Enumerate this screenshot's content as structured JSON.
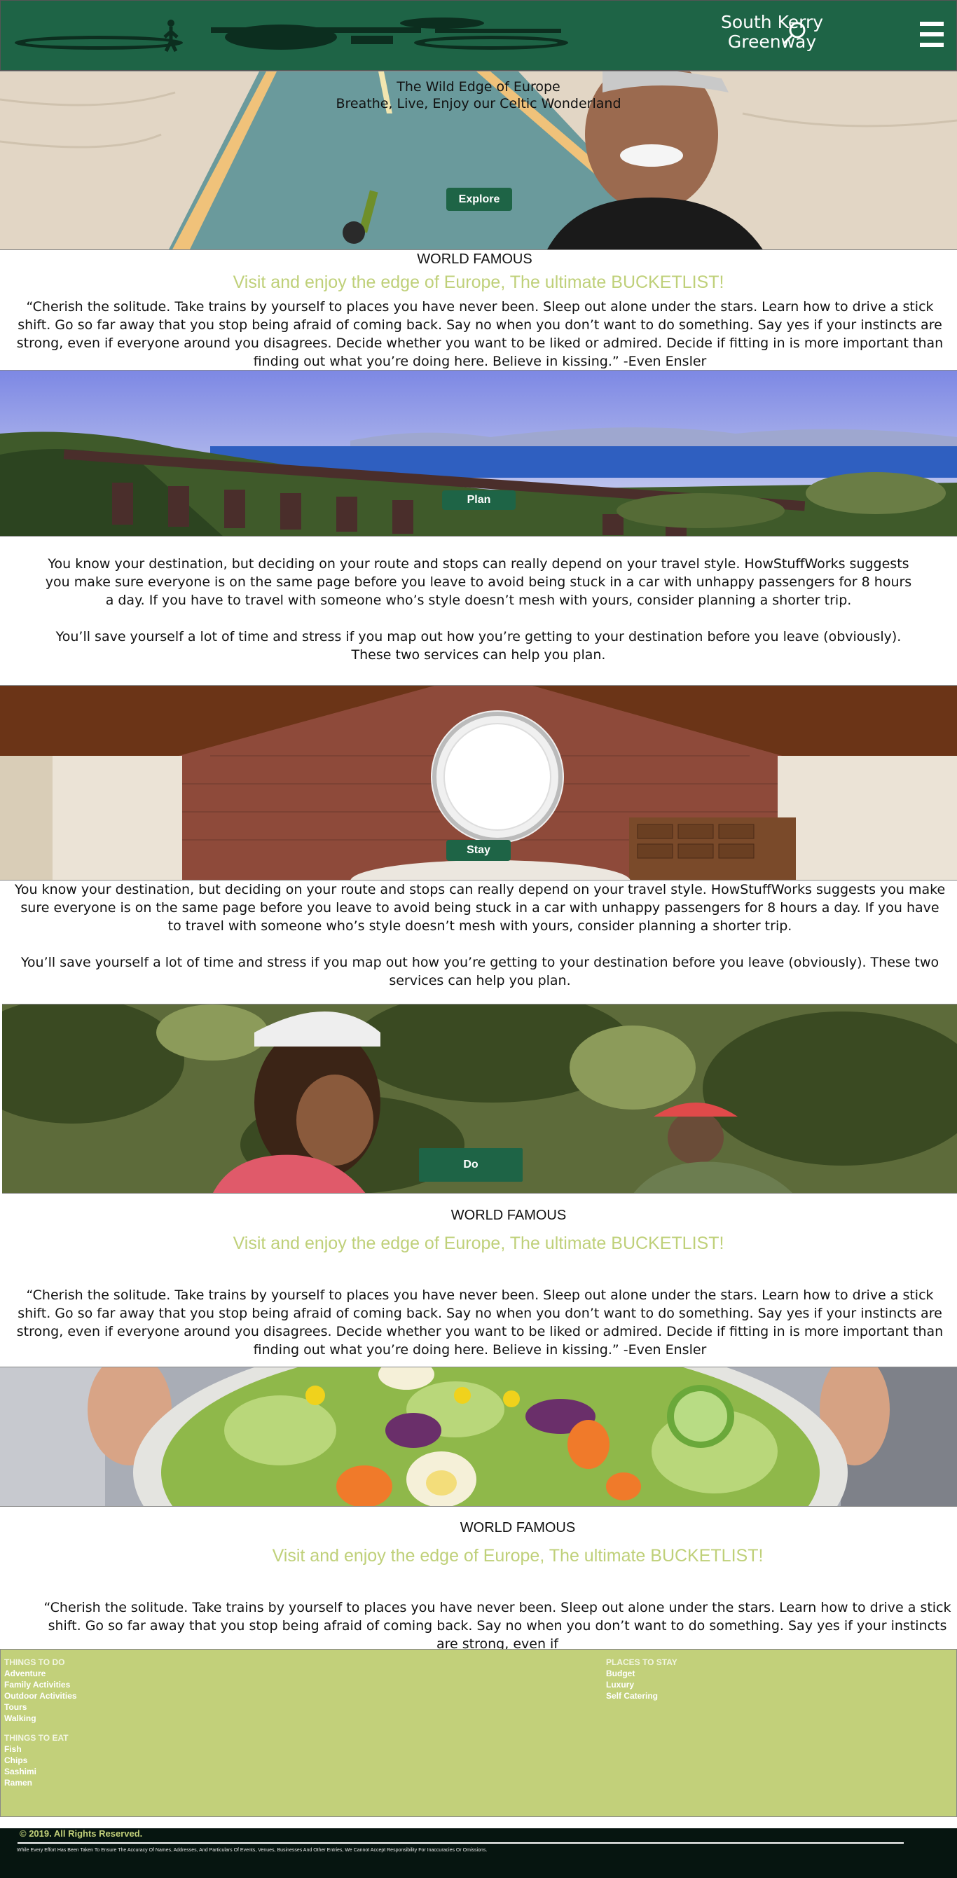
{
  "header": {
    "brand_line1": "South Kerry",
    "brand_line2": "Greenway",
    "menu_icon": "hamburger-icon",
    "search_icon": "search-icon",
    "bg_color": "#1e6446"
  },
  "hero": {
    "title": "The Wild Edge of Europe",
    "subtitle": "Breathe, Live, Enjoy our Celtic Wonderland",
    "button": "Explore"
  },
  "section1": {
    "kicker": "WORLD FAMOUS",
    "headline": "Visit and enjoy the edge of Europe, The ultimate BUCKETLIST!",
    "quote": "“Cherish the solitude. Take trains by yourself to places you have never been. Sleep out alone under the stars. Learn how to drive a stick shift. Go so far away that you stop being afraid of coming back. Say no when you don’t want to do something. Say yes if your instincts are strong, even if everyone around you disagrees. Decide whether you want to be liked or admired. Decide if fitting in is more important than finding out what you’re doing here. Believe in kissing.” -Even Ensler"
  },
  "plan": {
    "button": "Plan",
    "para1": "You know your destination, but deciding on your route and stops can really depend on your travel style. HowStuffWorks suggests you make sure everyone is on the same page before you leave to avoid being stuck in a car with unhappy passengers for 8 hours a day. If you have to travel with someone who’s style doesn’t mesh with yours, consider planning a shorter trip.",
    "para2": "You’ll save yourself a lot of time and stress if you map out how you’re getting to your destination before you leave (obviously). These two services can help you plan."
  },
  "stay": {
    "button": "Stay",
    "para1": "You know your destination, but deciding on your route and stops can really depend on your travel style. HowStuffWorks suggests you make sure everyone is on the same page before you leave to avoid being stuck in a car with unhappy passengers for 8 hours a day. If you have to travel with someone who’s style doesn’t mesh with yours, consider planning a shorter trip.",
    "para2": "You’ll save yourself a lot of time and stress if you map out how you’re getting to your destination before you leave (obviously). These two services can help you plan."
  },
  "do": {
    "button": "Do",
    "kicker": "WORLD FAMOUS",
    "headline": "Visit and enjoy the edge of Europe, The ultimate BUCKETLIST!",
    "quote": "“Cherish the solitude. Take trains by yourself to places you have never been. Sleep out alone under the stars. Learn how to drive a stick shift. Go so far away that you stop being afraid of coming back. Say no when you don’t want to do something. Say yes if your instincts are strong, even if everyone around you disagrees. Decide whether you want to be liked or admired. Decide if fitting in is more important than finding out what you’re doing here. Believe in kissing.” -Even Ensler"
  },
  "eat": {
    "kicker": "WORLD FAMOUS",
    "headline": "Visit and enjoy the edge of Europe, The ultimate BUCKETLIST!",
    "quote": "“Cherish the solitude. Take trains by yourself to places you have never been. Sleep out alone under the stars. Learn how to drive a stick shift. Go so far away that you stop being afraid of coming back. Say no when you don’t want to do something. Say yes if your instincts are strong, even if"
  },
  "footer": {
    "bg_color": "#c2d07a",
    "things_to_do": {
      "heading": "THINGS TO DO",
      "items": [
        "Adventure",
        "Family Activities",
        "Outdoor Activities",
        "Tours",
        "Walking"
      ]
    },
    "things_to_eat": {
      "heading": "THINGS TO EAT",
      "items": [
        "Fish",
        "Chips",
        "Sashimi",
        "Ramen"
      ]
    },
    "places_to_stay": {
      "heading": "PLACES  TO STAY",
      "items": [
        "Budget",
        "Luxury",
        "Self Catering"
      ]
    },
    "copyright": "© 2019. All Rights Reserved.",
    "disclaimer": "While Every Effort Has Been Taken To Ensure The Accuracy Of Names, Addresses, And Particulars Of Events, Venues, Businesses And Other Entries, We Cannot Accept Responsibility For Inaccuracies Or Omissions."
  }
}
